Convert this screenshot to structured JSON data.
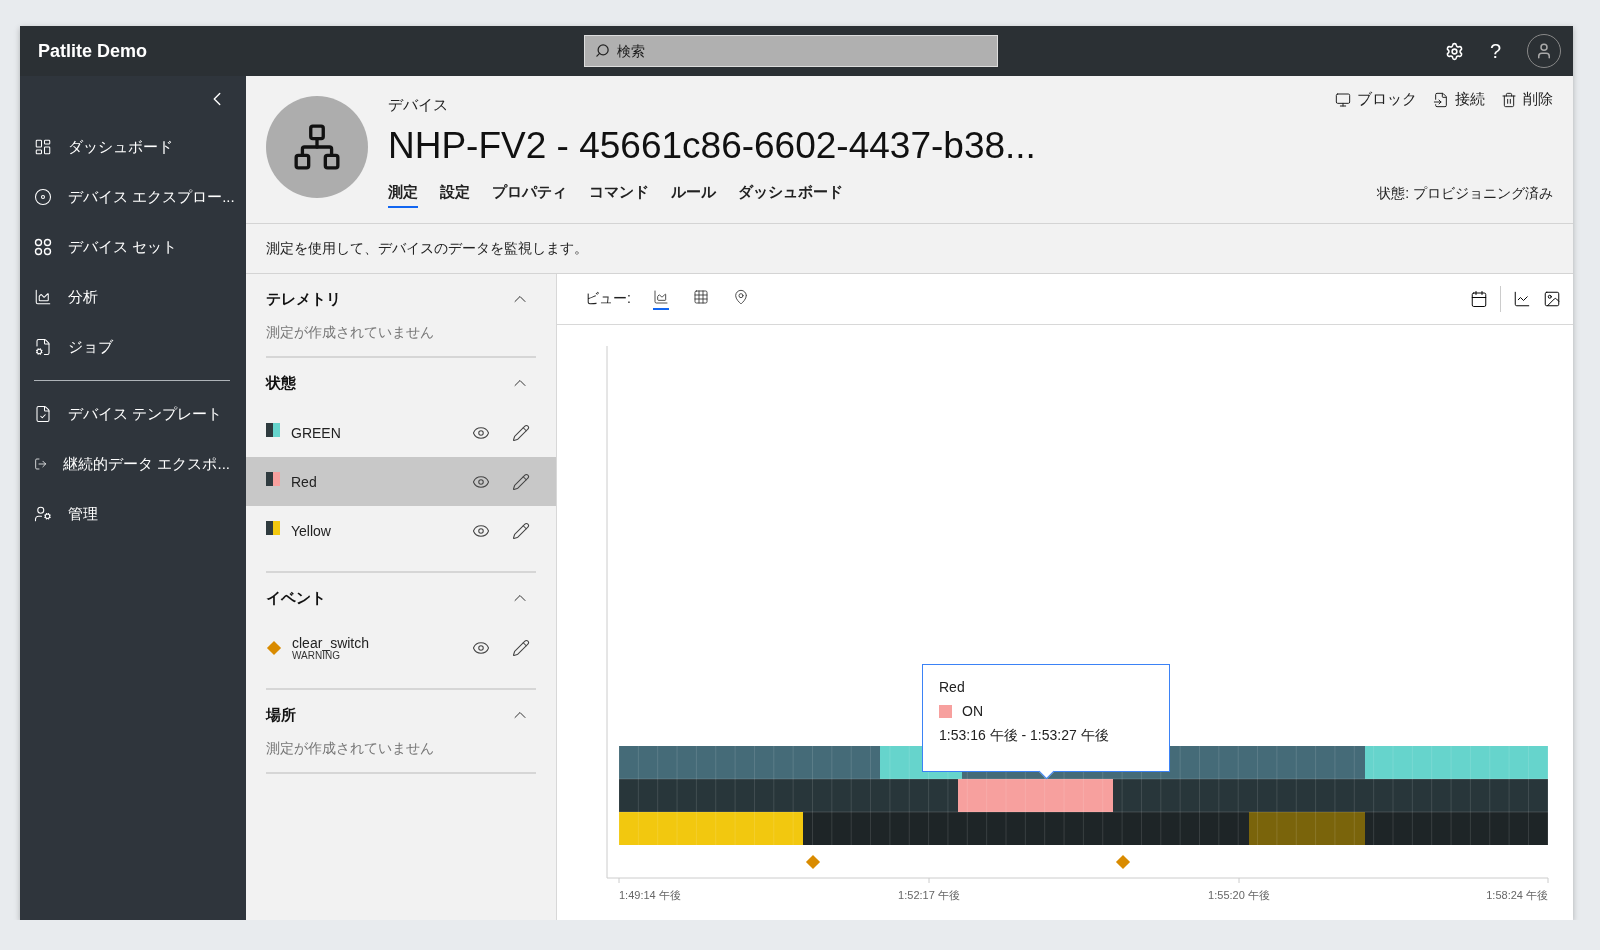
{
  "app": {
    "title": "Patlite Demo",
    "help_label": "?"
  },
  "search": {
    "placeholder": "検索"
  },
  "sidebar": {
    "groups": [
      [
        {
          "label": "ダッシュボード"
        },
        {
          "label": "デバイス エクスプロー..."
        },
        {
          "label": "デバイス セット"
        },
        {
          "label": "分析"
        },
        {
          "label": "ジョブ"
        }
      ],
      [
        {
          "label": "デバイス テンプレート"
        },
        {
          "label": "継続的データ エクスポ..."
        },
        {
          "label": "管理"
        }
      ]
    ]
  },
  "device": {
    "type_label": "デバイス",
    "name": "NHP-FV2 - 45661c86-6602-4437-b38...",
    "actions": [
      "ブロック",
      "接続",
      "削除"
    ],
    "status": "状態: プロビジョニング済み",
    "tabs": [
      {
        "label": "測定",
        "selected": true
      },
      {
        "label": "設定",
        "selected": false
      },
      {
        "label": "プロパティ",
        "selected": false
      },
      {
        "label": "コマンド",
        "selected": false
      },
      {
        "label": "ルール",
        "selected": false
      },
      {
        "label": "ダッシュボード",
        "selected": false
      }
    ]
  },
  "description": "測定を使用して、デバイスのデータを監視します。",
  "sections": [
    {
      "title": "テレメトリ",
      "expanded": true,
      "empty_text": "測定が作成されていません"
    },
    {
      "title": "状態",
      "expanded": true,
      "items": [
        {
          "kind": "state",
          "name": "GREEN",
          "color": "#66d4cc",
          "selected": false
        },
        {
          "kind": "state",
          "name": "Red",
          "color": "#f7a09e",
          "selected": true
        },
        {
          "kind": "state",
          "name": "Yellow",
          "color": "#f2c80f",
          "selected": false
        }
      ]
    },
    {
      "title": "イベント",
      "expanded": true,
      "items": [
        {
          "kind": "event",
          "name": "clear_switch",
          "severity": "WARNING",
          "color": "#d98b00",
          "selected": false
        }
      ]
    },
    {
      "title": "場所",
      "expanded": true,
      "empty_text": "測定が作成されていません"
    }
  ],
  "view_bar": {
    "label": "ビュー:",
    "views": [
      {
        "selected": true
      },
      {
        "selected": false
      },
      {
        "selected": false
      }
    ]
  },
  "timeline": {
    "x_ticks": [
      "1:49:14 午後",
      "1:52:17 午後",
      "1:55:20 午後",
      "1:58:24 午後"
    ],
    "tooltip": {
      "title": "Red",
      "value": "ON",
      "color": "#f7a09e",
      "range": "1:53:16 午後 - 1:53:27 午後"
    }
  }
}
